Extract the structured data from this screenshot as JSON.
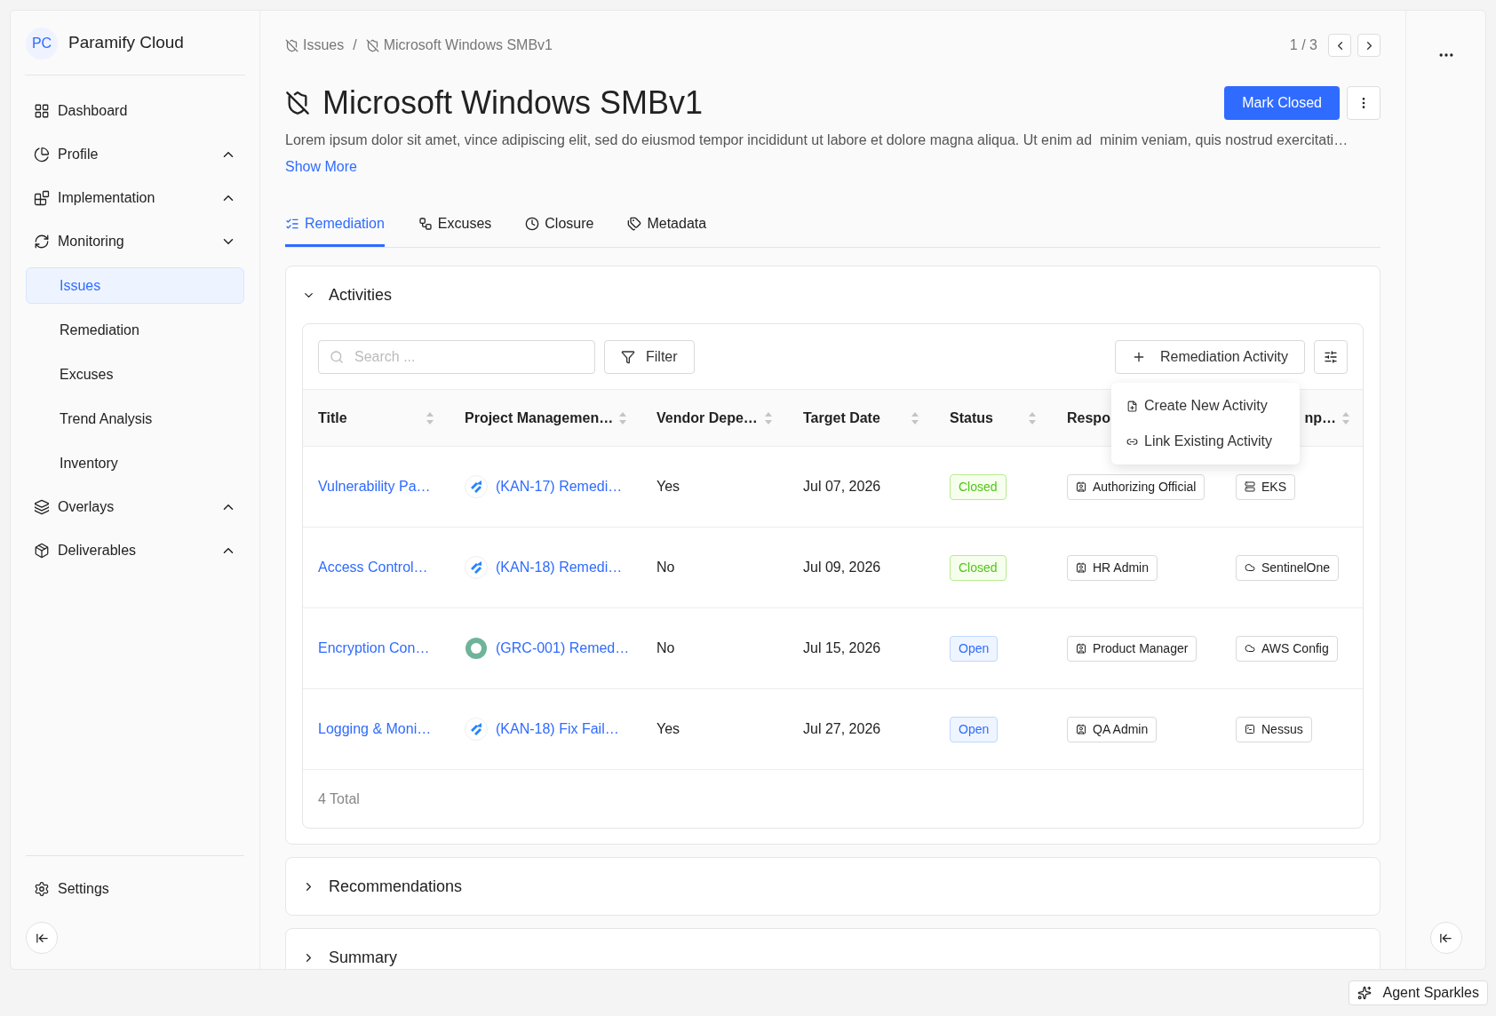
{
  "sidebar": {
    "avatar": "PC",
    "title": "Paramify Cloud",
    "items": [
      {
        "label": "Dashboard",
        "selected": false
      },
      {
        "label": "Profile",
        "expanded": false,
        "selected": false
      },
      {
        "label": "Implementation",
        "expanded": false,
        "selected": false
      },
      {
        "label": "Monitoring",
        "expanded": true,
        "selected": false,
        "children": [
          {
            "label": "Issues",
            "selected": true
          },
          {
            "label": "Remediation",
            "selected": false
          },
          {
            "label": "Excuses",
            "selected": false
          },
          {
            "label": "Trend Analysis",
            "selected": false
          },
          {
            "label": "Inventory",
            "selected": false
          }
        ]
      },
      {
        "label": "Overlays",
        "expanded": false,
        "selected": false
      },
      {
        "label": "Deliverables",
        "expanded": false,
        "selected": false
      }
    ],
    "settings": "Settings"
  },
  "breadcrumb": {
    "items": [
      "Issues",
      "Microsoft Windows SMBv1"
    ],
    "separator": "/"
  },
  "pager": "1 / 3",
  "title": "Microsoft Windows SMBv1",
  "primary_button": "Mark Closed",
  "description": "Lorem ipsum dolor sit amet, vince adipiscing elit, sed do eiusmod tempor incididunt ut labore et dolore magna aliqua. Ut enim ad  minim veniam, quis nostrud exercitati…",
  "show_more": "Show More",
  "tabs": [
    {
      "label": "Remediation",
      "selected": true
    },
    {
      "label": "Excuses",
      "selected": false
    },
    {
      "label": "Closure",
      "selected": false
    },
    {
      "label": "Metadata",
      "selected": false
    }
  ],
  "sections": [
    {
      "title": "Activities",
      "expanded": true
    },
    {
      "title": "Recommendations",
      "expanded": false
    },
    {
      "title": "Summary",
      "expanded": false
    }
  ],
  "toolbar": {
    "search_placeholder": "Search ...",
    "filter": "Filter",
    "add_button": "Remediation Activity"
  },
  "menu": [
    "Create New Activity",
    "Link Existing Activity"
  ],
  "table": {
    "columns": [
      "Title",
      "Project Managemen…",
      "Vendor Depe…",
      "Target Date",
      "Status",
      "Respo",
      "np…"
    ],
    "rows": [
      {
        "title": "Vulnerability Pa…",
        "pm": {
          "kind": "jira",
          "text": "(KAN-17) Remedi…"
        },
        "vendor": "Yes",
        "date": "Jul 07, 2026",
        "status": {
          "kind": "closed",
          "text": "Closed"
        },
        "responsible": "Authorizing Official",
        "component": {
          "kind": "cluster",
          "text": "EKS"
        }
      },
      {
        "title": "Access Control…",
        "pm": {
          "kind": "jira",
          "text": "(KAN-18) Remedi…"
        },
        "vendor": "No",
        "date": "Jul 09, 2026",
        "status": {
          "kind": "closed",
          "text": "Closed"
        },
        "responsible": "HR Admin",
        "component": {
          "kind": "cloud",
          "text": "SentinelOne"
        }
      },
      {
        "title": "Encryption Con…",
        "pm": {
          "kind": "avatar",
          "text": "(GRC-001) Remed…"
        },
        "vendor": "No",
        "date": "Jul 15, 2026",
        "status": {
          "kind": "open",
          "text": "Open"
        },
        "responsible": "Product Manager",
        "component": {
          "kind": "cloud",
          "text": "AWS Config"
        }
      },
      {
        "title": "Logging & Moni…",
        "pm": {
          "kind": "jira",
          "text": "(KAN-18) Fix Fail…"
        },
        "vendor": "Yes",
        "date": "Jul 27, 2026",
        "status": {
          "kind": "open",
          "text": "Open"
        },
        "responsible": "QA Admin",
        "component": {
          "kind": "terminal",
          "text": "Nessus"
        }
      }
    ],
    "total": "4 Total"
  },
  "agent_button": "Agent Sparkles"
}
